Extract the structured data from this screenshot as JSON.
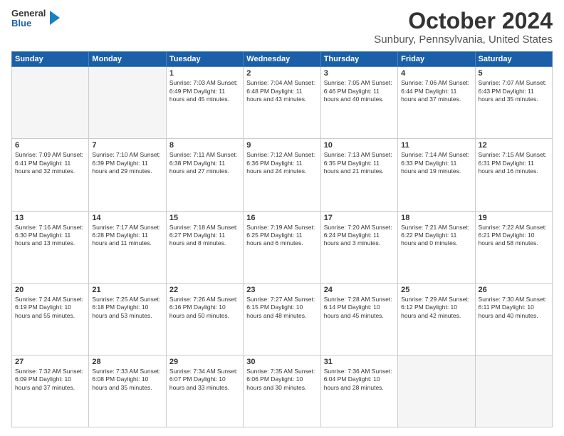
{
  "header": {
    "logo_line1": "General",
    "logo_line2": "Blue",
    "title": "October 2024",
    "subtitle": "Sunbury, Pennsylvania, United States"
  },
  "weekdays": [
    "Sunday",
    "Monday",
    "Tuesday",
    "Wednesday",
    "Thursday",
    "Friday",
    "Saturday"
  ],
  "weeks": [
    [
      {
        "day": "",
        "info": ""
      },
      {
        "day": "",
        "info": ""
      },
      {
        "day": "1",
        "info": "Sunrise: 7:03 AM\nSunset: 6:49 PM\nDaylight: 11 hours and 45 minutes."
      },
      {
        "day": "2",
        "info": "Sunrise: 7:04 AM\nSunset: 6:48 PM\nDaylight: 11 hours and 43 minutes."
      },
      {
        "day": "3",
        "info": "Sunrise: 7:05 AM\nSunset: 6:46 PM\nDaylight: 11 hours and 40 minutes."
      },
      {
        "day": "4",
        "info": "Sunrise: 7:06 AM\nSunset: 6:44 PM\nDaylight: 11 hours and 37 minutes."
      },
      {
        "day": "5",
        "info": "Sunrise: 7:07 AM\nSunset: 6:43 PM\nDaylight: 11 hours and 35 minutes."
      }
    ],
    [
      {
        "day": "6",
        "info": "Sunrise: 7:09 AM\nSunset: 6:41 PM\nDaylight: 11 hours and 32 minutes."
      },
      {
        "day": "7",
        "info": "Sunrise: 7:10 AM\nSunset: 6:39 PM\nDaylight: 11 hours and 29 minutes."
      },
      {
        "day": "8",
        "info": "Sunrise: 7:11 AM\nSunset: 6:38 PM\nDaylight: 11 hours and 27 minutes."
      },
      {
        "day": "9",
        "info": "Sunrise: 7:12 AM\nSunset: 6:36 PM\nDaylight: 11 hours and 24 minutes."
      },
      {
        "day": "10",
        "info": "Sunrise: 7:13 AM\nSunset: 6:35 PM\nDaylight: 11 hours and 21 minutes."
      },
      {
        "day": "11",
        "info": "Sunrise: 7:14 AM\nSunset: 6:33 PM\nDaylight: 11 hours and 19 minutes."
      },
      {
        "day": "12",
        "info": "Sunrise: 7:15 AM\nSunset: 6:31 PM\nDaylight: 11 hours and 16 minutes."
      }
    ],
    [
      {
        "day": "13",
        "info": "Sunrise: 7:16 AM\nSunset: 6:30 PM\nDaylight: 11 hours and 13 minutes."
      },
      {
        "day": "14",
        "info": "Sunrise: 7:17 AM\nSunset: 6:28 PM\nDaylight: 11 hours and 11 minutes."
      },
      {
        "day": "15",
        "info": "Sunrise: 7:18 AM\nSunset: 6:27 PM\nDaylight: 11 hours and 8 minutes."
      },
      {
        "day": "16",
        "info": "Sunrise: 7:19 AM\nSunset: 6:25 PM\nDaylight: 11 hours and 6 minutes."
      },
      {
        "day": "17",
        "info": "Sunrise: 7:20 AM\nSunset: 6:24 PM\nDaylight: 11 hours and 3 minutes."
      },
      {
        "day": "18",
        "info": "Sunrise: 7:21 AM\nSunset: 6:22 PM\nDaylight: 11 hours and 0 minutes."
      },
      {
        "day": "19",
        "info": "Sunrise: 7:22 AM\nSunset: 6:21 PM\nDaylight: 10 hours and 58 minutes."
      }
    ],
    [
      {
        "day": "20",
        "info": "Sunrise: 7:24 AM\nSunset: 6:19 PM\nDaylight: 10 hours and 55 minutes."
      },
      {
        "day": "21",
        "info": "Sunrise: 7:25 AM\nSunset: 6:18 PM\nDaylight: 10 hours and 53 minutes."
      },
      {
        "day": "22",
        "info": "Sunrise: 7:26 AM\nSunset: 6:16 PM\nDaylight: 10 hours and 50 minutes."
      },
      {
        "day": "23",
        "info": "Sunrise: 7:27 AM\nSunset: 6:15 PM\nDaylight: 10 hours and 48 minutes."
      },
      {
        "day": "24",
        "info": "Sunrise: 7:28 AM\nSunset: 6:14 PM\nDaylight: 10 hours and 45 minutes."
      },
      {
        "day": "25",
        "info": "Sunrise: 7:29 AM\nSunset: 6:12 PM\nDaylight: 10 hours and 42 minutes."
      },
      {
        "day": "26",
        "info": "Sunrise: 7:30 AM\nSunset: 6:11 PM\nDaylight: 10 hours and 40 minutes."
      }
    ],
    [
      {
        "day": "27",
        "info": "Sunrise: 7:32 AM\nSunset: 6:09 PM\nDaylight: 10 hours and 37 minutes."
      },
      {
        "day": "28",
        "info": "Sunrise: 7:33 AM\nSunset: 6:08 PM\nDaylight: 10 hours and 35 minutes."
      },
      {
        "day": "29",
        "info": "Sunrise: 7:34 AM\nSunset: 6:07 PM\nDaylight: 10 hours and 33 minutes."
      },
      {
        "day": "30",
        "info": "Sunrise: 7:35 AM\nSunset: 6:06 PM\nDaylight: 10 hours and 30 minutes."
      },
      {
        "day": "31",
        "info": "Sunrise: 7:36 AM\nSunset: 6:04 PM\nDaylight: 10 hours and 28 minutes."
      },
      {
        "day": "",
        "info": ""
      },
      {
        "day": "",
        "info": ""
      }
    ]
  ]
}
